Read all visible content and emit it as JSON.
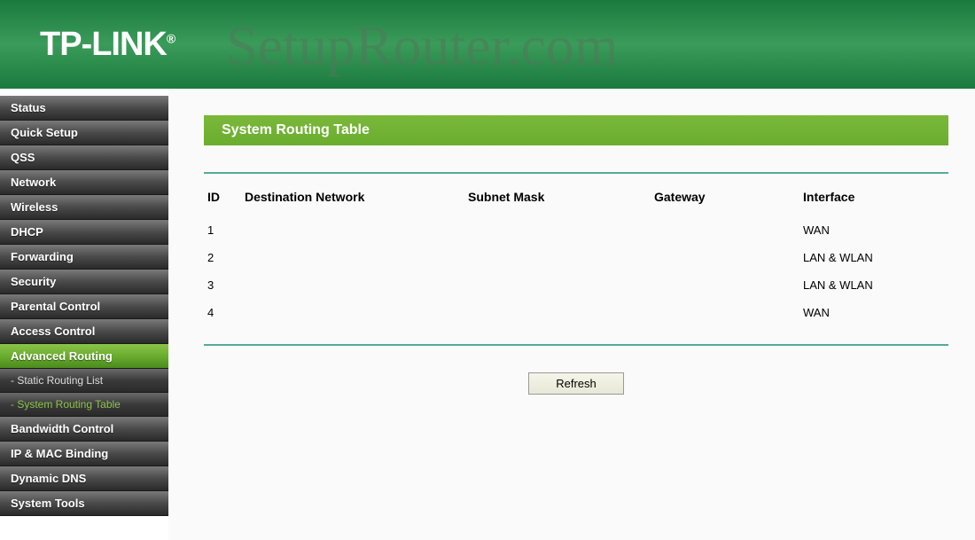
{
  "header": {
    "brand": "TP-LINK",
    "brand_mark": "®"
  },
  "watermark": "SetupRouter.com",
  "sidebar": {
    "items": [
      {
        "label": "Status",
        "active": false
      },
      {
        "label": "Quick Setup",
        "active": false
      },
      {
        "label": "QSS",
        "active": false
      },
      {
        "label": "Network",
        "active": false
      },
      {
        "label": "Wireless",
        "active": false
      },
      {
        "label": "DHCP",
        "active": false
      },
      {
        "label": "Forwarding",
        "active": false
      },
      {
        "label": "Security",
        "active": false
      },
      {
        "label": "Parental Control",
        "active": false
      },
      {
        "label": "Access Control",
        "active": false
      },
      {
        "label": "Advanced Routing",
        "active": true,
        "children": [
          {
            "label": "- Static Routing List",
            "active": false
          },
          {
            "label": "- System Routing Table",
            "active": true
          }
        ]
      },
      {
        "label": "Bandwidth Control",
        "active": false
      },
      {
        "label": "IP & MAC Binding",
        "active": false
      },
      {
        "label": "Dynamic DNS",
        "active": false
      },
      {
        "label": "System Tools",
        "active": false
      }
    ]
  },
  "main": {
    "title": "System Routing Table",
    "columns": {
      "id": "ID",
      "dest": "Destination Network",
      "subnet": "Subnet Mask",
      "gateway": "Gateway",
      "interface": "Interface"
    },
    "rows": [
      {
        "id": "1",
        "dest": "",
        "subnet": "",
        "gateway": "",
        "interface": "WAN"
      },
      {
        "id": "2",
        "dest": "",
        "subnet": "",
        "gateway": "",
        "interface": "LAN & WLAN"
      },
      {
        "id": "3",
        "dest": "",
        "subnet": "",
        "gateway": "",
        "interface": "LAN & WLAN"
      },
      {
        "id": "4",
        "dest": "",
        "subnet": "",
        "gateway": "",
        "interface": "WAN"
      }
    ],
    "refresh_label": "Refresh"
  }
}
